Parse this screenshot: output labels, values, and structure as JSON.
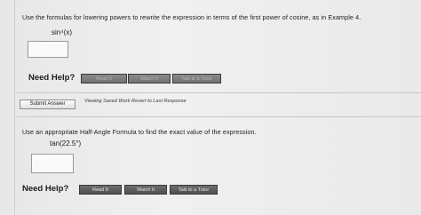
{
  "question1": {
    "prompt": "Use the formulas for lowering powers to rewrite the expression in terms of the first power of cosine, as in Example 4.",
    "expression": "sin⁴(x)",
    "answer_value": "",
    "need_help_label": "Need Help?",
    "buttons": [
      "Read It",
      "Watch It",
      "Talk to a Tutor"
    ],
    "submit_label": "Submit Answer",
    "saved_work_note": "Viewing Saved Work Revert to Last Response"
  },
  "question2": {
    "prompt": "Use an appropriate Half-Angle Formula to find the exact value of the expression.",
    "expression": "tan(22.5°)",
    "answer_value": "",
    "need_help_label": "Need Help?",
    "buttons": [
      "Read It",
      "Watch It",
      "Talk to a Tutor"
    ]
  }
}
